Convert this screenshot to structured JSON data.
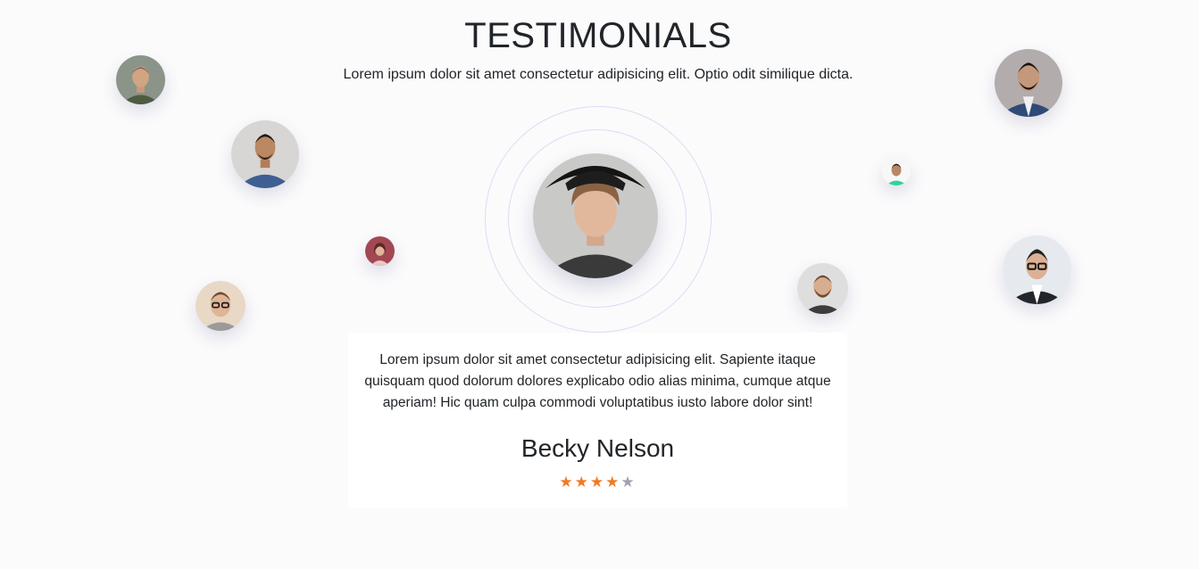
{
  "header": {
    "title": "TESTIMONIALS",
    "subtitle": "Lorem ipsum dolor sit amet consectetur adipisicing elit. Optio odit similique dicta."
  },
  "testimonial": {
    "quote": "Lorem ipsum dolor sit amet consectetur adipisicing elit. Sapiente itaque quisquam quod dolorum dolores explicabo odio alias minima, cumque atque aperiam! Hic quam culpa commodi voluptatibus iusto labore dolor sint!",
    "name": "Becky Nelson",
    "rating": 4,
    "rating_max": 5,
    "star_on_color": "#f07a22",
    "star_off_color": "#9ea3ab"
  },
  "avatars": [
    {
      "icon": "avatar-man-green-jacket",
      "bg": "#7a8a7a"
    },
    {
      "icon": "avatar-man-blue-shirt",
      "bg": "#d8d8d8"
    },
    {
      "icon": "avatar-woman-red",
      "bg": "#a04a50"
    },
    {
      "icon": "avatar-man-glasses",
      "bg": "#e6d2c0"
    },
    {
      "icon": "avatar-featured-curly-hair-hat",
      "bg": "#c8c8c8"
    },
    {
      "icon": "avatar-man-green-shirt",
      "bg": "#ffffff"
    },
    {
      "icon": "avatar-man-beard",
      "bg": "#e0e0e0"
    },
    {
      "icon": "avatar-man-suit",
      "bg": "#b5aeae"
    },
    {
      "icon": "avatar-man-glasses-suit",
      "bg": "#e8ecf0"
    }
  ]
}
